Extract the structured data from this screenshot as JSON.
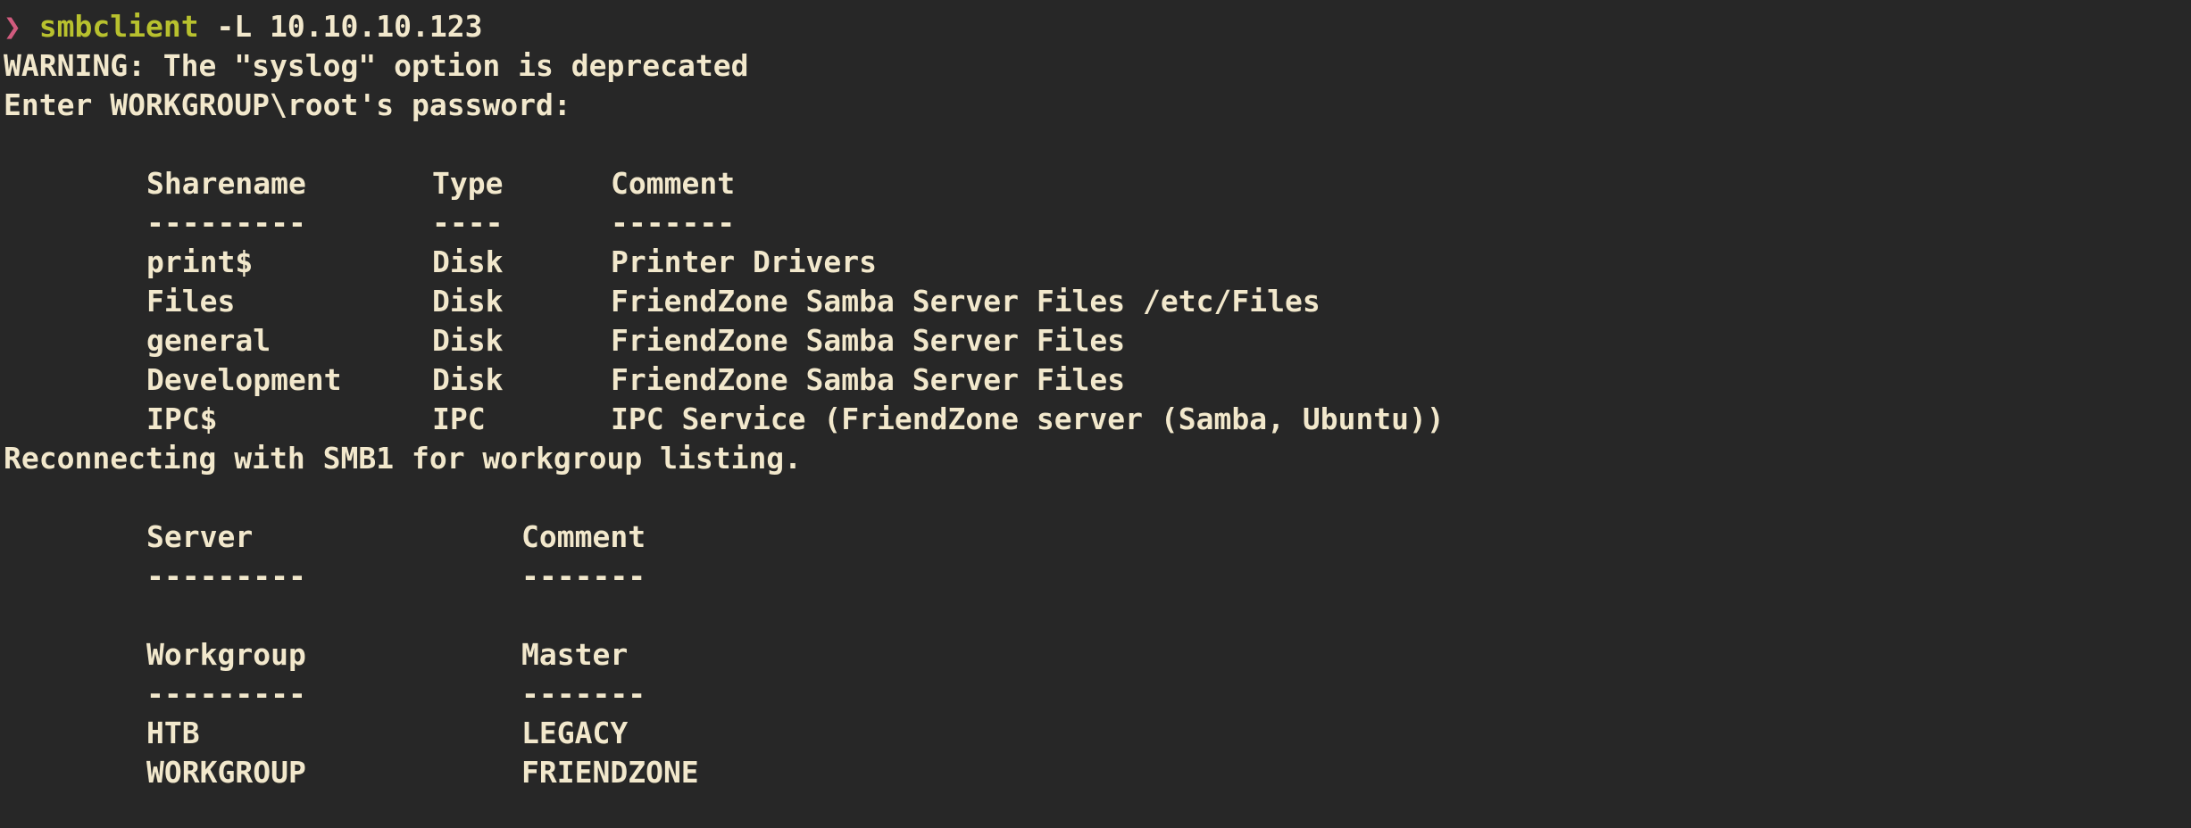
{
  "window": {
    "background": "#272727",
    "text_color": "#f2e8cc",
    "prompt_arrow_color": "#d15b7e",
    "command_color": "#b8c12e"
  },
  "prompt": {
    "arrow": "❯",
    "command": "smbclient",
    "args": " -L 10.10.10.123"
  },
  "output": {
    "warning": "WARNING: The \"syslog\" option is deprecated",
    "password_prompt": "Enter WORKGROUP\\root's password:",
    "share_headers": [
      "Sharename",
      "Type",
      "Comment"
    ],
    "share_rules": [
      "---------",
      "----",
      "-------"
    ],
    "shares": [
      {
        "name": "print$",
        "type": "Disk",
        "comment": "Printer Drivers"
      },
      {
        "name": "Files",
        "type": "Disk",
        "comment": "FriendZone Samba Server Files /etc/Files"
      },
      {
        "name": "general",
        "type": "Disk",
        "comment": "FriendZone Samba Server Files"
      },
      {
        "name": "Development",
        "type": "Disk",
        "comment": "FriendZone Samba Server Files"
      },
      {
        "name": "IPC$",
        "type": "IPC",
        "comment": "IPC Service (FriendZone server (Samba, Ubuntu))"
      }
    ],
    "reconnect": "Reconnecting with SMB1 for workgroup listing.",
    "server_headers": [
      "Server",
      "Comment"
    ],
    "server_rules": [
      "---------",
      "-------"
    ],
    "workgroup_headers": [
      "Workgroup",
      "Master"
    ],
    "workgroup_rules": [
      "---------",
      "-------"
    ],
    "workgroups": [
      {
        "name": "HTB",
        "master": "LEGACY"
      },
      {
        "name": "WORKGROUP",
        "master": "FRIENDZONE"
      }
    ]
  }
}
